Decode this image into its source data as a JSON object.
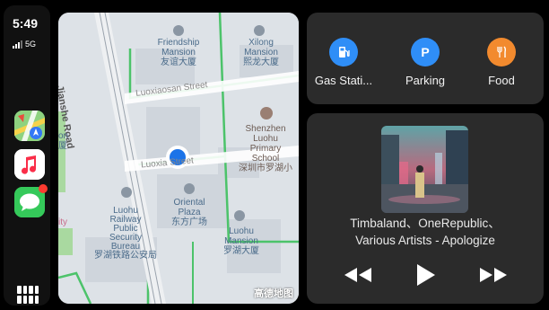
{
  "status_bar": {
    "time": "5:49",
    "network": "5G"
  },
  "dock": {
    "apps": [
      {
        "name": "Maps",
        "icon": "maps-icon"
      },
      {
        "name": "Music",
        "icon": "music-icon"
      },
      {
        "name": "Messages",
        "icon": "messages-icon",
        "badge": true
      }
    ],
    "app_grid_icon": "app-grid-icon"
  },
  "map": {
    "labels": {
      "friendship_en": "Friendship",
      "mansion_en": "Mansion",
      "friendship_cn": "友谊大厦",
      "xilong_en": "Xilong",
      "xilong_mansion_en": "Mansion",
      "xilong_cn": "熙龙大厦",
      "jianshe_road": "Jianshe Road",
      "luoxiaosan_street": "Luoxiaosan Street",
      "street_mid": "Luoxia Street",
      "school_1": "Shenzhen",
      "school_2": "Luohu",
      "school_3": "Primary",
      "school_4": "School",
      "school_cn": "深圳市罗湖小",
      "oriental_1": "Oriental",
      "oriental_2": "Plaza",
      "oriental_cn": "东方广场",
      "railway_1": "Luohu",
      "railway_2": "Railway",
      "railway_3": "Public",
      "railway_4": "Security",
      "railway_5": "Bureau",
      "railway_cn": "罗湖铁路公安局",
      "luohu_mansion_1": "Luohu",
      "luohu_mansion_2": "Mansion",
      "luohu_mansion_cn": "罗湖大厦",
      "left_on": "on",
      "left_xia": "厦",
      "left_ity": "ity",
      "watermark": "高德地图"
    }
  },
  "shortcuts": [
    {
      "label": "Gas Stati...",
      "icon": "gas-station-icon",
      "color": "#2f8ef7"
    },
    {
      "label": "Parking",
      "icon": "parking-icon",
      "color": "#2f8ef7",
      "glyph": "P"
    },
    {
      "label": "Food",
      "icon": "food-icon",
      "color": "#f28a2e"
    }
  ],
  "now_playing": {
    "artists": "Timbaland、OneRepublic、",
    "line2": "Various Artists - Apologize",
    "controls": [
      "previous-track",
      "play",
      "next-track"
    ]
  }
}
